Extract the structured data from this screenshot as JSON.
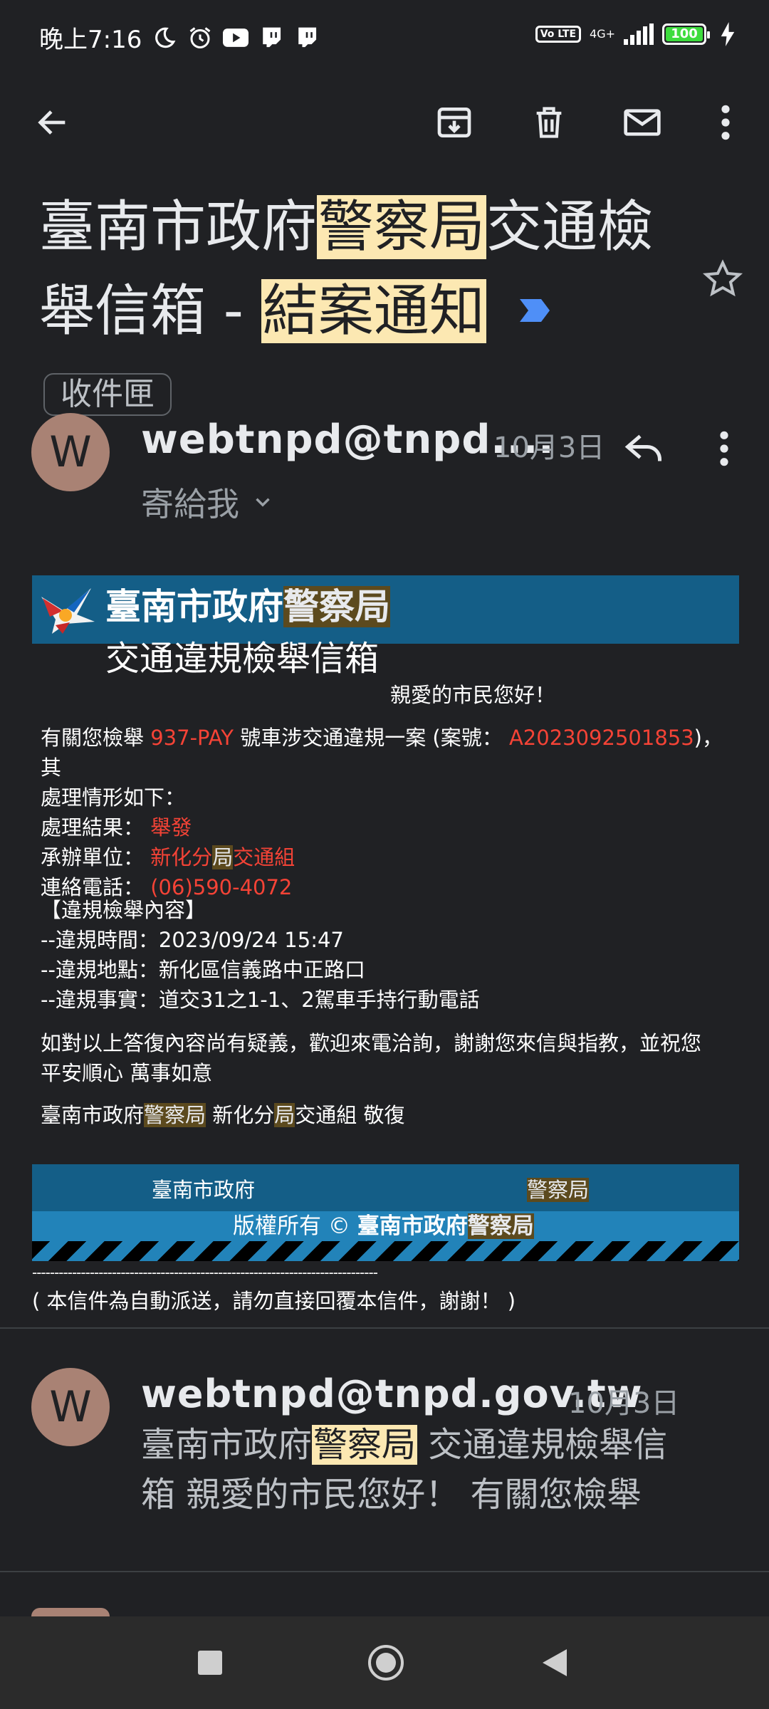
{
  "status_bar": {
    "time": "晚上7:16",
    "volte": "Vo LTE",
    "network": "4G+",
    "battery": "100"
  },
  "email": {
    "subject": {
      "part1": "臺南市政府",
      "part2_highlight": "警察局",
      "part3": "交通檢",
      "part4": "舉信箱 - ",
      "part5_highlight": "結案通知"
    },
    "label": "收件匣",
    "sender_short": "webtnpd@tnpd....",
    "date": "10月3日",
    "to_me": "寄給我",
    "avatar_letter": "W"
  },
  "body": {
    "banner_title_a": "臺南市政府",
    "banner_title_b": "警察局",
    "banner_sub": "交通違規檢舉信箱",
    "greeting": "親愛的市民您好！",
    "p1_a": "有關您檢舉 ",
    "plate": "937-PAY",
    "p1_b": " 號車涉交通違規一案 (案號：",
    "case_no": "A2023092501853",
    "p1_c": ")，其",
    "p1_d": "處理情形如下：",
    "result_label": "處理結果：",
    "result_value": "舉發",
    "unit_label": "承辦單位：",
    "unit_a": "新化分",
    "unit_b": "局",
    "unit_c": "交通組",
    "phone_label": "連絡電話：",
    "phone_value": "(06)590-4072",
    "section_title": "【違規檢舉內容】",
    "time_line": "--違規時間：2023/09/24 15:47",
    "place_line": "--違規地點：新化區信義路中正路口",
    "fact_line": "--違規事實：道交31之1-1、2駕車手持行動電話",
    "closing_1": "如對以上答復內容尚有疑義，歡迎來電洽詢，謝謝您來信與指教，並祝您",
    "closing_2": "平安順心 萬事如意",
    "sign_a": "臺南市政府",
    "sign_b": "警察局",
    "sign_c": " 新化分",
    "sign_d": "局",
    "sign_e": "交通組 敬復",
    "footer_left": "臺南市政府",
    "footer_right": "警察局",
    "copyright_a": "版權所有 © ",
    "copyright_b": "臺南市政府",
    "copyright_c": "警察局",
    "dash_line": "------------------------------------------------------------------------------",
    "auto_note": "( 本信件為自動派送，請勿直接回覆本信件，謝謝！ )"
  },
  "second_message": {
    "avatar_letter": "W",
    "sender": "webtnpd@tnpd.gov.tw",
    "date": "10月3日",
    "snippet_a": "臺南市政府",
    "snippet_b": "警察局",
    "snippet_c": " 交通違規檢舉信",
    "snippet_d": "箱 親愛的市民您好！ 有關您檢舉"
  },
  "colors": {
    "background": "#202124",
    "highlight": "#fce8b2",
    "banner_blue": "#145e87",
    "red_text": "#f44336"
  }
}
